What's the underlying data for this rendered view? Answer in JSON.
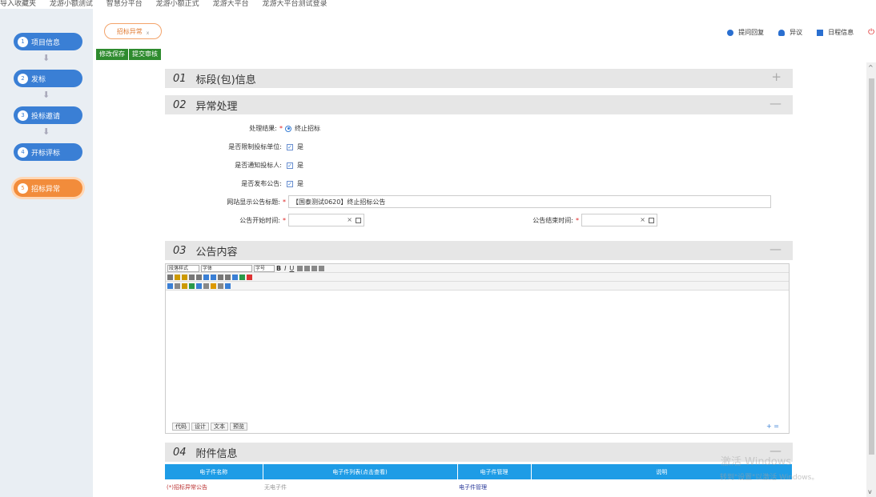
{
  "bookmarks": [
    "导入收藏夹",
    "龙游小额测试",
    "智慧分平台",
    "龙游小额正式",
    "龙游大平台",
    "龙游大平台测试登录"
  ],
  "steps": [
    {
      "num": "1",
      "label": "项目信息"
    },
    {
      "num": "2",
      "label": "发标"
    },
    {
      "num": "3",
      "label": "投标邀请"
    },
    {
      "num": "4",
      "label": "开标评标"
    },
    {
      "num": "5",
      "label": "招标异常"
    }
  ],
  "tab": {
    "label": "招标异常",
    "close": "x"
  },
  "toplinks": [
    {
      "label": "提问回复",
      "icon": "chat-icon",
      "color": "#2a6fd0"
    },
    {
      "label": "异议",
      "icon": "user-icon",
      "color": "#2a6fd0"
    },
    {
      "label": "日程信息",
      "icon": "calendar-icon",
      "color": "#2a6fd0"
    }
  ],
  "actions": {
    "save": "修改保存",
    "submit": "提交审核"
  },
  "sections": [
    {
      "num": "01",
      "title": "标段(包)信息",
      "toggle": "+"
    },
    {
      "num": "02",
      "title": "异常处理",
      "toggle": "—"
    },
    {
      "num": "03",
      "title": "公告内容",
      "toggle": "—"
    },
    {
      "num": "04",
      "title": "附件信息",
      "toggle": "—"
    }
  ],
  "form": {
    "result_label": "处理结果:",
    "result_value": "终止招标",
    "limit_label": "是否限制投标单位:",
    "limit_value": "是",
    "notify_label": "是否通知投标人:",
    "notify_value": "是",
    "publish_label": "是否发布公告:",
    "publish_value": "是",
    "site_title_label": "网站显示公告标题:",
    "site_title_value": "【国泰测试0620】终止招标公告",
    "start_label": "公告开始时间:",
    "end_label": "公告结束时间:",
    "date_clear": "×"
  },
  "editor": {
    "para_format": "段落样式",
    "font": "字体",
    "size": "字号",
    "modes": [
      "代码",
      "设计",
      "文本",
      "预览"
    ],
    "zoom": "+ ="
  },
  "attach": {
    "headers": [
      "电子件名称",
      "电子件列表(点击查看)",
      "电子件管理",
      "说明"
    ],
    "rows": [
      {
        "name": "(*)招标异常公告",
        "list": "无电子件",
        "manage": "电子件管理",
        "desc": ""
      }
    ]
  },
  "watermark": {
    "line1": "激活 Windows",
    "line2": "转到\"设置\"以激活 Windows。"
  }
}
